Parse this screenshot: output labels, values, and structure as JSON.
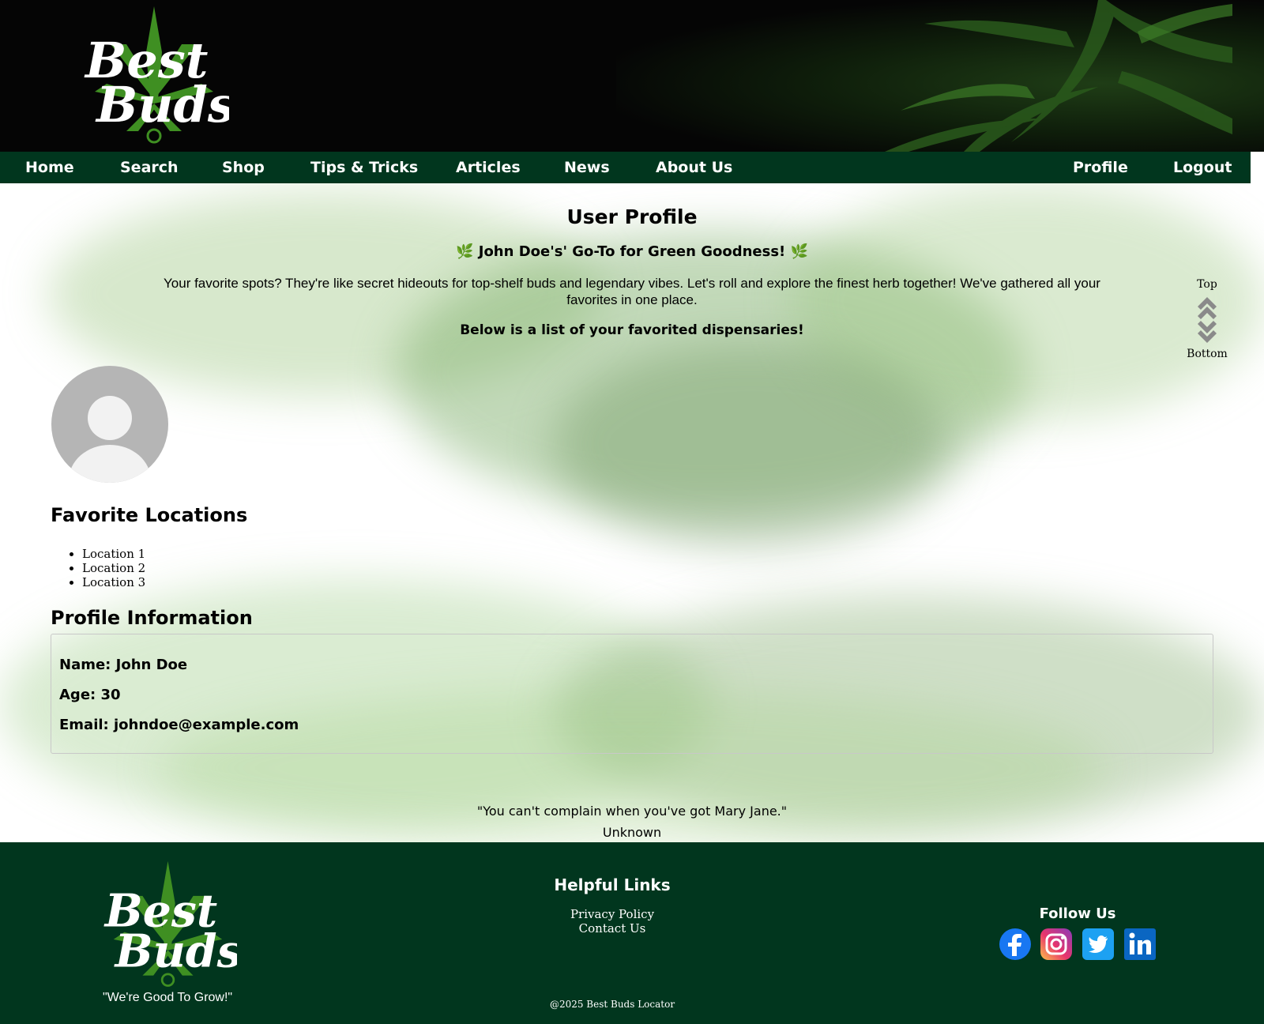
{
  "brand": {
    "logo_text_top": "Best",
    "logo_text_bottom": "Buds",
    "tagline": "\"We're Good To Grow!\""
  },
  "nav": {
    "left": [
      "Home",
      "Search",
      "Shop",
      "Tips & Tricks",
      "Articles",
      "News",
      "About Us"
    ],
    "right": [
      "Profile",
      "Logout"
    ]
  },
  "page": {
    "title": "User Profile",
    "tagline": "🌿 John Doe's' Go-To for Green Goodness! 🌿",
    "intro": "Your favorite spots? They're like secret hideouts for top-shelf buds and legendary vibes. Let's roll and explore the finest herb together! We've gathered all your favorites in one place.",
    "below": "Below is a list of your favorited dispensaries!"
  },
  "scroll_controls": {
    "top_label": "Top",
    "bottom_label": "Bottom"
  },
  "favorites": {
    "heading": "Favorite Locations",
    "items": [
      "Location 1",
      "Location 2",
      "Location 3"
    ]
  },
  "profile": {
    "heading": "Profile Information",
    "name": "Name: John Doe",
    "age": "Age: 30",
    "email": "Email: johndoe@example.com"
  },
  "quote": {
    "text": "\"You can't complain when you've got Mary Jane.\"",
    "author": "Unknown"
  },
  "footer": {
    "links_heading": "Helpful Links",
    "links": [
      "Privacy Policy",
      "Contact Us"
    ],
    "copyright": "@2025 Best Buds Locator",
    "follow_heading": "Follow Us",
    "social_icons": [
      "facebook-icon",
      "instagram-icon",
      "twitter-icon",
      "linkedin-icon"
    ]
  },
  "colors": {
    "nav_bg": "#01361e",
    "footer_bg": "#01361e",
    "leaf_green": "#3f8f22"
  }
}
